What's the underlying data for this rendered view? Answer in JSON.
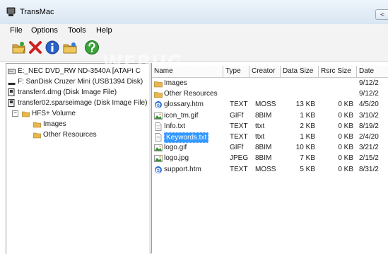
{
  "window": {
    "title": "TransMac",
    "control_glyph": "<"
  },
  "menu": {
    "items": [
      "File",
      "Options",
      "Tools",
      "Help"
    ]
  },
  "toolbar": {
    "buttons": [
      {
        "icon": "open-folder-icon",
        "color": "#d8a53a"
      },
      {
        "icon": "close-x-icon",
        "color": "#d11f1f"
      },
      {
        "icon": "info-icon",
        "color": "#2a62c9"
      },
      {
        "icon": "folder-icon",
        "color": "#d8a53a"
      },
      {
        "icon": "help-icon",
        "color": "#3aa33a"
      }
    ]
  },
  "watermark": {
    "text": "WEBUG",
    "suffix": ".com"
  },
  "tree": {
    "items": [
      {
        "label": "E:_NEC DVD_RW ND-3540A [ATAPI C",
        "icon": "dvd-drive-icon"
      },
      {
        "label": "F: SanDisk Cruzer Mini (USB1394 Disk)",
        "icon": "usb-drive-icon"
      },
      {
        "label": "transfer4.dmg (Disk Image File)",
        "icon": "disk-image-icon"
      },
      {
        "label": "transfer02.sparseimage (Disk Image File)",
        "icon": "disk-image-icon"
      },
      {
        "label": "HFS+ Volume",
        "icon": "folder-icon",
        "expander": "−"
      },
      {
        "label": "Images",
        "icon": "folder-icon"
      },
      {
        "label": "Other Resources",
        "icon": "folder-icon"
      }
    ]
  },
  "files": {
    "columns": [
      "Name",
      "Type",
      "Creator",
      "Data Size",
      "Rsrc Size",
      "Date"
    ],
    "rows": [
      {
        "name": "Images",
        "type": "",
        "creator": "",
        "data_size": "",
        "rsrc_size": "",
        "date": "9/12/2",
        "icon": "folder-icon",
        "selected": false
      },
      {
        "name": "Other Resources",
        "type": "",
        "creator": "",
        "data_size": "",
        "rsrc_size": "",
        "date": "9/12/2",
        "icon": "folder-icon",
        "selected": false
      },
      {
        "name": "glossary.htm",
        "type": "TEXT",
        "creator": "MOSS",
        "data_size": "13 KB",
        "rsrc_size": "0 KB",
        "date": "4/5/20",
        "icon": "html-file-icon",
        "selected": false
      },
      {
        "name": "icon_tm.gif",
        "type": "GIFf",
        "creator": "8BIM",
        "data_size": "1 KB",
        "rsrc_size": "0 KB",
        "date": "3/10/2",
        "icon": "image-file-icon",
        "selected": false
      },
      {
        "name": "Info.txt",
        "type": "TEXT",
        "creator": "ttxt",
        "data_size": "2 KB",
        "rsrc_size": "0 KB",
        "date": "8/19/2",
        "icon": "text-file-icon",
        "selected": false
      },
      {
        "name": "Keywords.txt",
        "type": "TEXT",
        "creator": "ttxt",
        "data_size": "1 KB",
        "rsrc_size": "0 KB",
        "date": "2/4/20",
        "icon": "text-file-icon",
        "selected": true
      },
      {
        "name": "logo.gif",
        "type": "GIFf",
        "creator": "8BIM",
        "data_size": "10 KB",
        "rsrc_size": "0 KB",
        "date": "3/21/2",
        "icon": "image-file-icon",
        "selected": false
      },
      {
        "name": "logo.jpg",
        "type": "JPEG",
        "creator": "8BIM",
        "data_size": "7 KB",
        "rsrc_size": "0 KB",
        "date": "2/15/2",
        "icon": "image-file-icon",
        "selected": false
      },
      {
        "name": "support.htm",
        "type": "TEXT",
        "creator": "MOSS",
        "data_size": "5 KB",
        "rsrc_size": "0 KB",
        "date": "8/31/2",
        "icon": "html-file-icon",
        "selected": false
      }
    ]
  }
}
